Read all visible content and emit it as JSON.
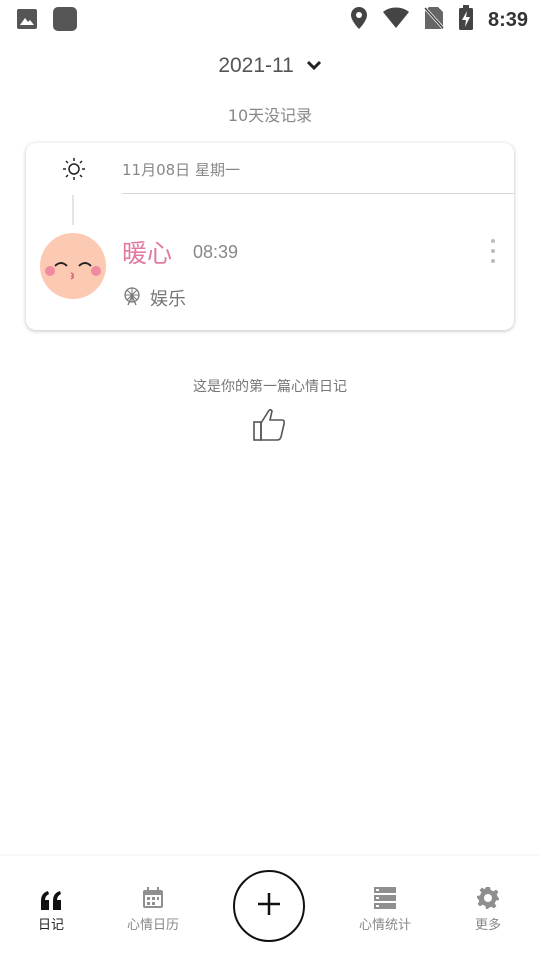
{
  "status_bar": {
    "time": "8:39",
    "icons": [
      "image-icon",
      "app-icon",
      "location-icon",
      "wifi-icon",
      "no-sim-icon",
      "battery-charging-icon"
    ]
  },
  "header": {
    "month": "2021-11",
    "no_record": "10天没记录"
  },
  "entry": {
    "weather_icon": "sun-icon",
    "date": "11月08日 星期一",
    "mood": "暖心",
    "time": "08:39",
    "activity_icon": "ferris-wheel-icon",
    "activity": "娱乐",
    "mood_color": "#e07aa3"
  },
  "tip": {
    "text": "这是你的第一篇心情日记",
    "icon": "thumbs-up-icon"
  },
  "bottom_nav": {
    "items": [
      {
        "label": "日记",
        "icon": "quote-icon",
        "active": true
      },
      {
        "label": "心情日历",
        "icon": "calendar-icon",
        "active": false
      },
      {
        "label": "",
        "icon": "plus-icon",
        "active": false
      },
      {
        "label": "心情统计",
        "icon": "stats-icon",
        "active": false
      },
      {
        "label": "更多",
        "icon": "gear-icon",
        "active": false
      }
    ]
  }
}
